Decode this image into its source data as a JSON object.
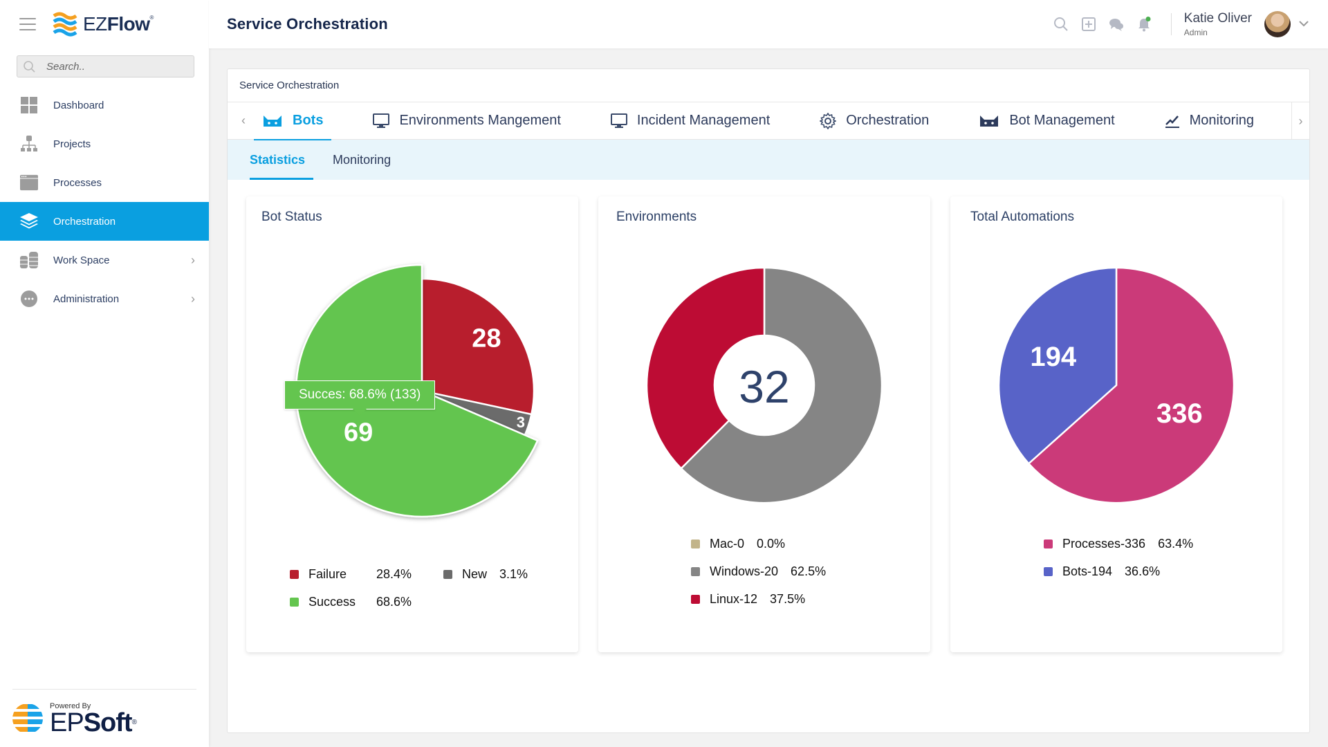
{
  "app": {
    "logo_text_light": "EZ",
    "logo_text_bold": "Flow",
    "logo_reg": "®"
  },
  "sidebar": {
    "search_placeholder": "Search..",
    "items": [
      {
        "label": "Dashboard",
        "icon": "dashboard-icon",
        "active": false,
        "has_children": false
      },
      {
        "label": "Projects",
        "icon": "projects-icon",
        "active": false,
        "has_children": false
      },
      {
        "label": "Processes",
        "icon": "processes-icon",
        "active": false,
        "has_children": false
      },
      {
        "label": "Orchestration",
        "icon": "layers-icon",
        "active": true,
        "has_children": false
      },
      {
        "label": "Work Space",
        "icon": "workspace-icon",
        "active": false,
        "has_children": true
      },
      {
        "label": "Administration",
        "icon": "more-icon",
        "active": false,
        "has_children": true
      }
    ],
    "footer": {
      "powered_by": "Powered By",
      "brand_light": "EP",
      "brand_bold": "Soft",
      "brand_reg": "®"
    }
  },
  "header": {
    "title": "Service Orchestration",
    "user": {
      "name": "Katie Oliver",
      "role": "Admin"
    },
    "icons": [
      "search-icon",
      "add-icon",
      "chat-icon",
      "bell-icon"
    ],
    "notification_dot_color": "#4caf50"
  },
  "panel": {
    "title": "Service Orchestration",
    "tabs": [
      {
        "label": "Bots",
        "icon": "bot-icon",
        "active": true
      },
      {
        "label": "Environments Mangement",
        "icon": "monitor-icon",
        "active": false
      },
      {
        "label": "Incident Management",
        "icon": "monitor-icon",
        "active": false
      },
      {
        "label": "Orchestration",
        "icon": "gear-icon",
        "active": false
      },
      {
        "label": "Bot Management",
        "icon": "bot-icon",
        "active": false
      },
      {
        "label": "Monitoring",
        "icon": "chart-line-icon",
        "active": false
      }
    ],
    "subtabs": [
      {
        "label": "Statistics",
        "active": true
      },
      {
        "label": "Monitoring",
        "active": false
      }
    ]
  },
  "colors": {
    "accent": "#0a9fe0",
    "failure": "#b81e2d",
    "new": "#6b6b6b",
    "success": "#64c54f",
    "mac": "#c2b48a",
    "windows": "#858585",
    "linux": "#bd0c34",
    "processes": "#cb3a79",
    "bots": "#5863c8"
  },
  "chart_data": [
    {
      "type": "pie",
      "title": "Bot Status",
      "categories": [
        "Failure",
        "New",
        "Success"
      ],
      "values": [
        28.4,
        3.1,
        68.6
      ],
      "data_labels": [
        "28",
        "3",
        "69"
      ],
      "legend": [
        {
          "label": "Failure",
          "percent": "28.4%",
          "color": "#b81e2d"
        },
        {
          "label": "New",
          "percent": "3.1%",
          "color": "#6b6b6b"
        },
        {
          "label": "Success",
          "percent": "68.6%",
          "color": "#64c54f"
        }
      ],
      "tooltip": "Succes: 68.6% (133)",
      "highlighted": "Success",
      "legend_position": "bottom"
    },
    {
      "type": "pie",
      "subtype": "donut",
      "title": "Environments",
      "categories": [
        "Mac",
        "Windows",
        "Linux"
      ],
      "values": [
        0,
        20,
        12
      ],
      "center_label": "32",
      "legend": [
        {
          "label": "Mac-0",
          "percent": "0.0%",
          "color": "#c2b48a"
        },
        {
          "label": "Windows-20",
          "percent": "62.5%",
          "color": "#858585"
        },
        {
          "label": "Linux-12",
          "percent": "37.5%",
          "color": "#bd0c34"
        }
      ],
      "legend_position": "bottom"
    },
    {
      "type": "pie",
      "title": "Total Automations",
      "categories": [
        "Processes",
        "Bots"
      ],
      "values": [
        336,
        194
      ],
      "data_labels": [
        "336",
        "194"
      ],
      "legend": [
        {
          "label": "Processes-336",
          "percent": "63.4%",
          "color": "#cb3a79"
        },
        {
          "label": "Bots-194",
          "percent": "36.6%",
          "color": "#5863c8"
        }
      ],
      "legend_position": "bottom"
    }
  ]
}
